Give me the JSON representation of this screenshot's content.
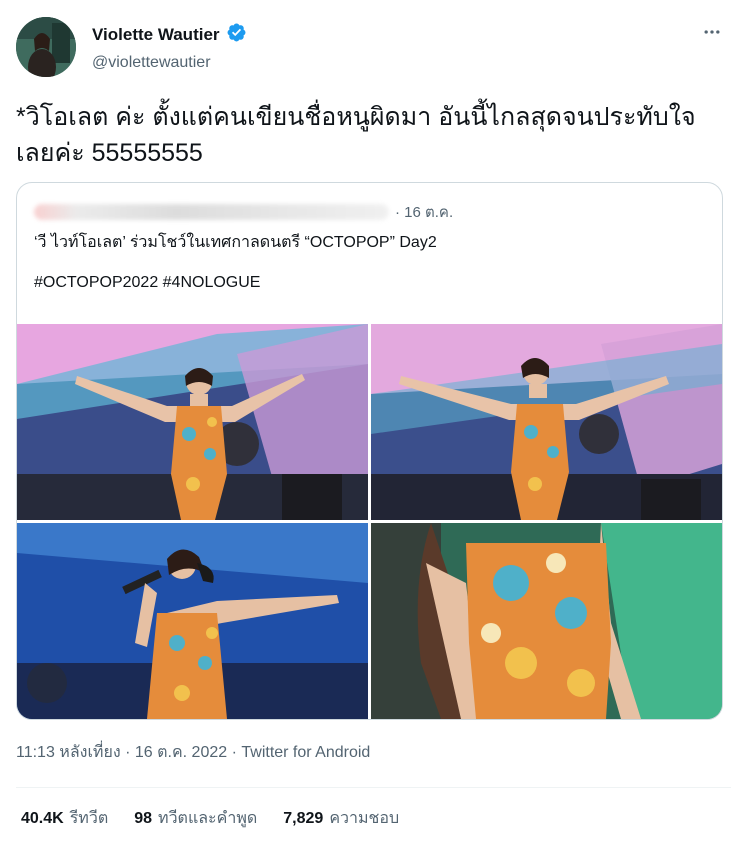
{
  "author": {
    "name": "Violette Wautier",
    "handle": "@violettewautier"
  },
  "tweet_text": "*วิโอเลต ค่ะ ตั้งแต่คนเขียนชื่อหนูผิดมา อันนี้ไกลสุดจนประทับใจเลยค่ะ 55555555",
  "quoted": {
    "author_blurred": "OCTOpus Entertainment @octopus_ent",
    "date": "· 16 ต.ค.",
    "text": "‘วี ไวท์โอเลต’ ร่วมโชว์ในเทศกาลดนตรี “OCTOPOP” Day2\n\n#OCTOPOP2022 #4NOLOGUE"
  },
  "meta": "11:13 หลังเที่ยง · 16 ต.ค. 2022 · Twitter for Android",
  "stats": [
    {
      "value": "40.4K",
      "label": "รีทวีต"
    },
    {
      "value": "98",
      "label": "ทวีตและคำพูด"
    },
    {
      "value": "7,829",
      "label": "ความชอบ"
    }
  ],
  "colors": {
    "accent": "#1d9bf0",
    "secondary_text": "#536471",
    "border": "#cfd9de"
  },
  "icons": {
    "verified": "verified-badge-icon",
    "more": "more-horizontal-icon"
  }
}
